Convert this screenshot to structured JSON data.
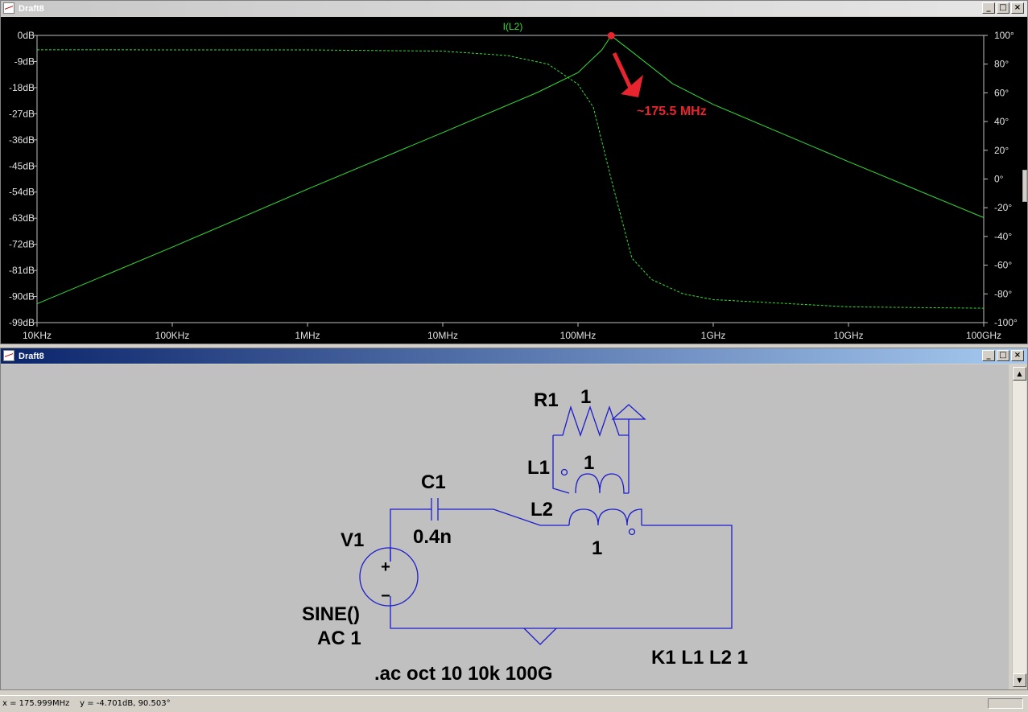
{
  "plot_window": {
    "title": "Draft8",
    "trace_label": "I(L2)",
    "annotation": "~175.5 MHz",
    "colors": {
      "background": "#000000",
      "trace": "#33dd33",
      "axis_text": "#e0e0e0",
      "annotation": "#e8242e"
    }
  },
  "chart_data": {
    "type": "line",
    "title": "I(L2)",
    "x_scale": "log",
    "x_ticks": [
      "10KHz",
      "100KHz",
      "1MHz",
      "10MHz",
      "100MHz",
      "1GHz",
      "10GHz",
      "100GHz"
    ],
    "x_tick_values": [
      10000.0,
      100000.0,
      1000000.0,
      10000000.0,
      100000000.0,
      1000000000.0,
      10000000000.0,
      100000000000.0
    ],
    "y_left_ticks": [
      "0dB",
      "-9dB",
      "-18dB",
      "-27dB",
      "-36dB",
      "-45dB",
      "-54dB",
      "-63dB",
      "-72dB",
      "-81dB",
      "-90dB",
      "-99dB"
    ],
    "y_left_range": [
      -99,
      0
    ],
    "y_right_ticks": [
      "100°",
      "80°",
      "60°",
      "40°",
      "20°",
      "0°",
      "-20°",
      "-40°",
      "-60°",
      "-80°",
      "-100°"
    ],
    "y_right_range": [
      -100,
      100
    ],
    "grid": false,
    "series": [
      {
        "name": "I(L2)",
        "style": "solid",
        "axis": "left",
        "x": [
          10000.0,
          100000.0,
          1000000.0,
          10000000.0,
          50000000.0,
          100000000.0,
          150000000.0,
          176000000.0,
          250000000.0,
          500000000.0,
          1000000000.0,
          10000000000.0,
          100000000000.0
        ],
        "y": [
          -92.5,
          -73,
          -53,
          -33.5,
          -19.7,
          -12.8,
          -5,
          -0.1,
          -5.6,
          -16.6,
          -23.8,
          -43.5,
          -62.8
        ]
      },
      {
        "name": "I(L2) phase",
        "style": "dashed",
        "axis": "right",
        "x": [
          10000.0,
          1000000.0,
          10000000.0,
          30000000.0,
          60000000.0,
          100000000.0,
          130000000.0,
          176000000.0,
          250000000.0,
          350000000.0,
          600000000.0,
          1000000000.0,
          10000000000.0,
          100000000000.0
        ],
        "y": [
          90,
          89.9,
          89,
          86,
          80,
          66,
          50,
          0,
          -55,
          -70,
          -80,
          -84,
          -89,
          -90
        ]
      }
    ],
    "marker": {
      "x": 176000000.0,
      "y": -0.1
    }
  },
  "schematic_window": {
    "title": "Draft8",
    "labels": {
      "r1": "R1",
      "r1_val": "1",
      "l1": "L1",
      "l1_val": "1",
      "c1": "C1",
      "c1_val": "0.4n",
      "l2": "L2",
      "l2_val": "1",
      "v1": "V1",
      "v1_fn": "SINE()",
      "v1_ac": "AC 1",
      "directive_ac": ".ac oct 10 10k 100G",
      "directive_k": "K1 L1 L2 1",
      "plus": "+",
      "minus": "−"
    },
    "colors": {
      "background": "#c0c0c0",
      "wire": "#1c1ccc",
      "text": "#000000"
    }
  },
  "status_bar": {
    "text": "x = 175.999MHz    y = -4.701dB, 90.503°"
  },
  "window_buttons": {
    "min": "_",
    "max": "□",
    "close": "×"
  }
}
